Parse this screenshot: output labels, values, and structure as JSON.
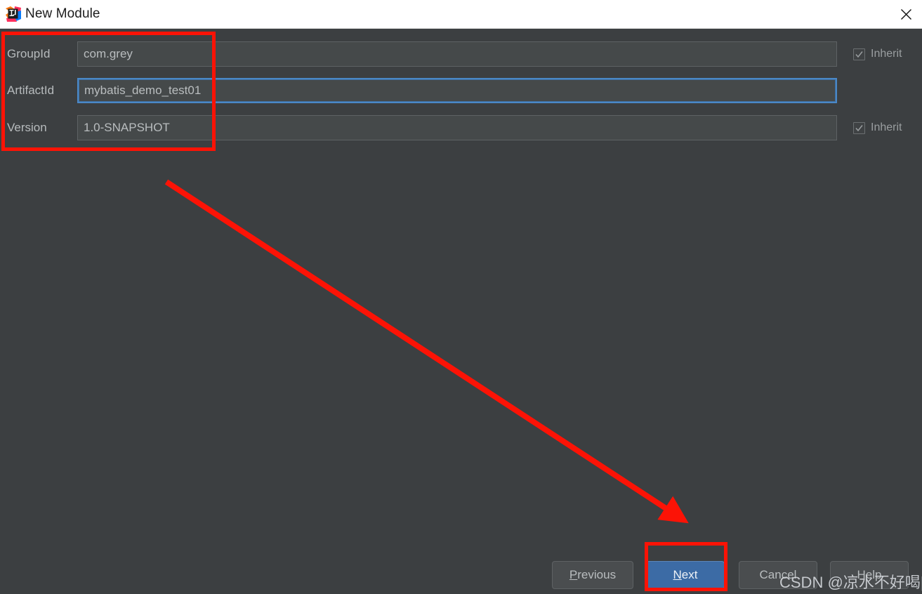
{
  "window": {
    "title": "New Module",
    "logo_icon": "intellij-idea-logo",
    "close_icon": "close-icon"
  },
  "form": {
    "fields": [
      {
        "label": "GroupId",
        "value": "com.grey",
        "focused": false,
        "inherit": {
          "label": "Inherit",
          "checked": true,
          "visible": true
        }
      },
      {
        "label": "ArtifactId",
        "value": "mybatis_demo_test01",
        "focused": true,
        "inherit": {
          "label": "",
          "checked": false,
          "visible": false
        }
      },
      {
        "label": "Version",
        "value": "1.0-SNAPSHOT",
        "focused": false,
        "inherit": {
          "label": "Inherit",
          "checked": true,
          "visible": true
        }
      }
    ]
  },
  "buttons": {
    "previous": {
      "label": "Previous",
      "mnemonic": "P",
      "style": "secondary"
    },
    "next": {
      "label": "Next",
      "mnemonic": "N",
      "style": "primary"
    },
    "cancel": {
      "label": "Cancel",
      "mnemonic": "",
      "style": "secondary"
    },
    "help": {
      "label": "Help",
      "mnemonic": "",
      "style": "secondary"
    }
  },
  "annotations": {
    "color": "#fc1306",
    "fields_highlight": "rectangle around GroupId, ArtifactId and Version fields",
    "next_highlight": "rectangle around Next button",
    "arrow": "red arrow pointing from form area to Next button"
  },
  "watermark": {
    "text": "CSDN @凉水不好喝||"
  },
  "colors": {
    "dialog_background": "#3c3f41",
    "titlebar_background": "#ffffff",
    "input_background": "#45494a",
    "focus_border": "#4a88c7",
    "primary_button": "#3c6ba5",
    "annotation_red": "#fc1306"
  }
}
